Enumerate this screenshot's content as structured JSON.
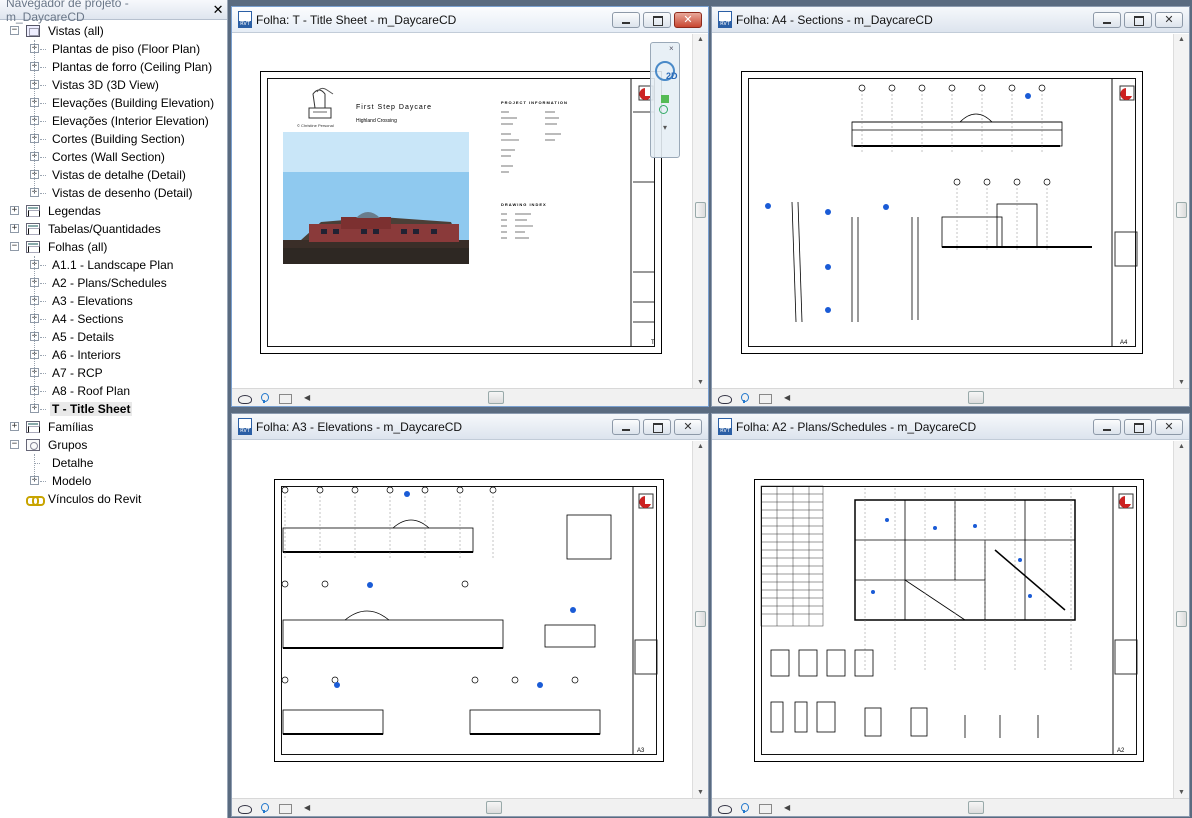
{
  "browser": {
    "title": "Navegador de projeto - m_DaycareCD",
    "close": "✕",
    "tree": [
      {
        "level": 0,
        "toggle": "−",
        "icon": "view",
        "label": "Vistas (all)"
      },
      {
        "level": 1,
        "toggle": "+",
        "label": "Plantas de piso (Floor Plan)"
      },
      {
        "level": 1,
        "toggle": "+",
        "label": "Plantas de forro (Ceiling Plan)"
      },
      {
        "level": 1,
        "toggle": "+",
        "label": "Vistas 3D (3D View)"
      },
      {
        "level": 1,
        "toggle": "+",
        "label": "Elevações (Building Elevation)"
      },
      {
        "level": 1,
        "toggle": "+",
        "label": "Elevações (Interior Elevation)"
      },
      {
        "level": 1,
        "toggle": "+",
        "label": "Cortes (Building Section)"
      },
      {
        "level": 1,
        "toggle": "+",
        "label": "Cortes (Wall Section)"
      },
      {
        "level": 1,
        "toggle": "+",
        "label": "Vistas de detalhe (Detail)"
      },
      {
        "level": 1,
        "toggle": "+",
        "label": "Vistas de desenho (Detail)"
      },
      {
        "level": 0,
        "toggle": "+",
        "icon": "sheet",
        "label": "Legendas"
      },
      {
        "level": 0,
        "toggle": "+",
        "icon": "sheet",
        "label": "Tabelas/Quantidades"
      },
      {
        "level": 0,
        "toggle": "−",
        "icon": "sheet",
        "label": "Folhas (all)"
      },
      {
        "level": 1,
        "toggle": "+",
        "label": "A1.1 - Landscape Plan"
      },
      {
        "level": 1,
        "toggle": "+",
        "label": "A2 - Plans/Schedules"
      },
      {
        "level": 1,
        "toggle": "+",
        "label": "A3 - Elevations"
      },
      {
        "level": 1,
        "toggle": "+",
        "label": "A4 - Sections"
      },
      {
        "level": 1,
        "toggle": "+",
        "label": "A5 - Details"
      },
      {
        "level": 1,
        "toggle": "+",
        "label": "A6 - Interiors"
      },
      {
        "level": 1,
        "toggle": "+",
        "label": "A7 - RCP"
      },
      {
        "level": 1,
        "toggle": "+",
        "label": "A8 - Roof Plan"
      },
      {
        "level": 1,
        "toggle": "+",
        "label": "T - Title Sheet",
        "selected": true
      },
      {
        "level": 0,
        "toggle": "+",
        "icon": "sheet",
        "label": "Famílias"
      },
      {
        "level": 0,
        "toggle": "−",
        "icon": "group",
        "label": "Grupos"
      },
      {
        "level": 1,
        "toggle": "",
        "label": "Detalhe"
      },
      {
        "level": 1,
        "toggle": "+",
        "label": "Modelo"
      },
      {
        "level": 0,
        "toggle": "",
        "icon": "link",
        "label": "Vínculos do Revit"
      }
    ]
  },
  "windows": [
    {
      "id": "t",
      "title": "Folha: T - Title Sheet - m_DaycareCD",
      "active": true,
      "sheet_number": "T"
    },
    {
      "id": "a4",
      "title": "Folha: A4 - Sections - m_DaycareCD",
      "active": false,
      "sheet_number": "A4"
    },
    {
      "id": "a3",
      "title": "Folha: A3 - Elevations - m_DaycareCD",
      "active": false,
      "sheet_number": "A3"
    },
    {
      "id": "a2",
      "title": "Folha: A2 - Plans/Schedules - m_DaycareCD",
      "active": false,
      "sheet_number": "A2"
    }
  ],
  "title_sheet": {
    "project_name": "First Step Daycare",
    "location": "Highland Crossing",
    "logo_caption": "© Christine Personal",
    "project_info_heading": "PROJECT INFORMATION",
    "drawing_index_heading": "DRAWING INDEX"
  },
  "navbar": {
    "mode_label": "2D"
  },
  "colors": {
    "window_border_active": "#7aa0d0",
    "close_active": "#c84530",
    "sky": "#8fc9ef",
    "brick": "#8a3a3a"
  }
}
